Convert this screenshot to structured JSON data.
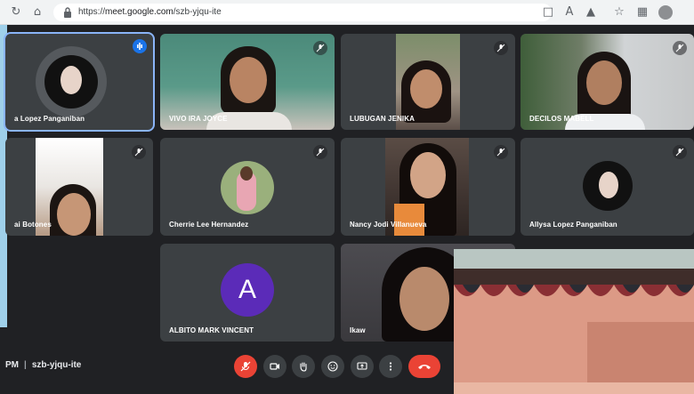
{
  "browser": {
    "url_protocol": "https://",
    "url_host": "meet.google.com",
    "url_path": "/szb-yjqu-ite"
  },
  "tiles": [
    {
      "name": "a Lopez Panganiban",
      "speaking": true
    },
    {
      "name": "VIVO IRA JOYCE",
      "muted": true
    },
    {
      "name": "LUBUGAN JENIKA",
      "muted": true
    },
    {
      "name": "DECILOS MABELL",
      "muted": true
    },
    {
      "name": "ai Botones",
      "muted": true
    },
    {
      "name": "Cherrie Lee Hernandez",
      "muted": true
    },
    {
      "name": "Nancy Jodi Villanueva",
      "muted": true
    },
    {
      "name": "Allysa Lopez Panganiban",
      "muted": true
    },
    {
      "name": "ALBITO MARK VINCENT",
      "avatar_letter": "A",
      "avatar_color": "#5b2bb8"
    },
    {
      "name": "Ikaw"
    }
  ],
  "footer": {
    "time_fragment": "PM",
    "meeting_code": "szb-yjqu-ite"
  },
  "controls": [
    {
      "icon": "mic-off-icon",
      "color": "#ea4335"
    },
    {
      "icon": "camera-icon"
    },
    {
      "icon": "raise-hand-icon"
    },
    {
      "icon": "emoji-icon"
    },
    {
      "icon": "present-screen-icon"
    },
    {
      "icon": "more-options-icon"
    },
    {
      "icon": "end-call-icon",
      "color": "#ea4335"
    }
  ],
  "colors": {
    "background": "#202124",
    "tile": "#3c4043",
    "accent": "#8ab4f8",
    "danger": "#ea4335"
  }
}
